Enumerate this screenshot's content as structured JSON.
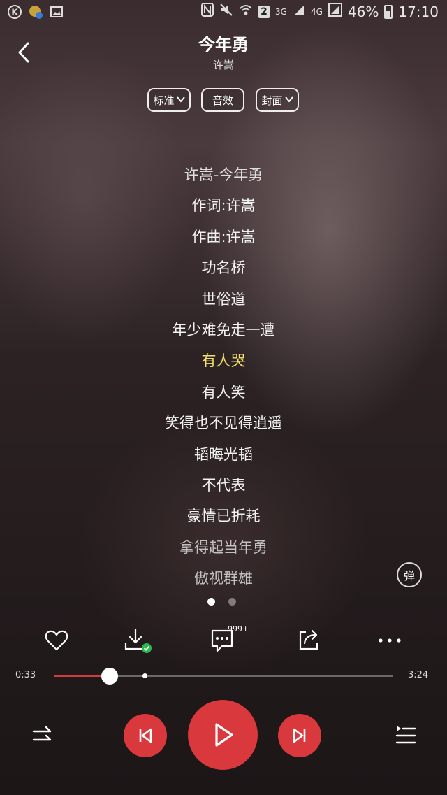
{
  "status_bar": {
    "left_icons": [
      "k-icon",
      "app-icon",
      "image-icon"
    ],
    "network_3g": "3G",
    "network_4g": "4G",
    "sim_badge": "2",
    "battery": "46%",
    "time": "17:10"
  },
  "song": {
    "title": "今年勇",
    "artist": "许嵩"
  },
  "options": {
    "quality": "标准",
    "effects": "音效",
    "cover": "封面"
  },
  "lyrics": [
    "许嵩-今年勇",
    "作词:许嵩",
    "作曲:许嵩",
    "功名桥",
    "世俗道",
    "年少难免走一遭",
    "有人哭",
    "有人笑",
    "笑得也不见得逍遥",
    "韬晦光韬",
    "不代表",
    "豪情已折耗",
    "拿得起当年勇",
    "傲视群雄"
  ],
  "danmu_label": "弹",
  "comment_count": "999+",
  "progress": {
    "current": "0:33",
    "total": "3:24",
    "fraction": 0.163
  },
  "colors": {
    "accent": "#d9383c",
    "active_lyric": "#f3e36a"
  }
}
